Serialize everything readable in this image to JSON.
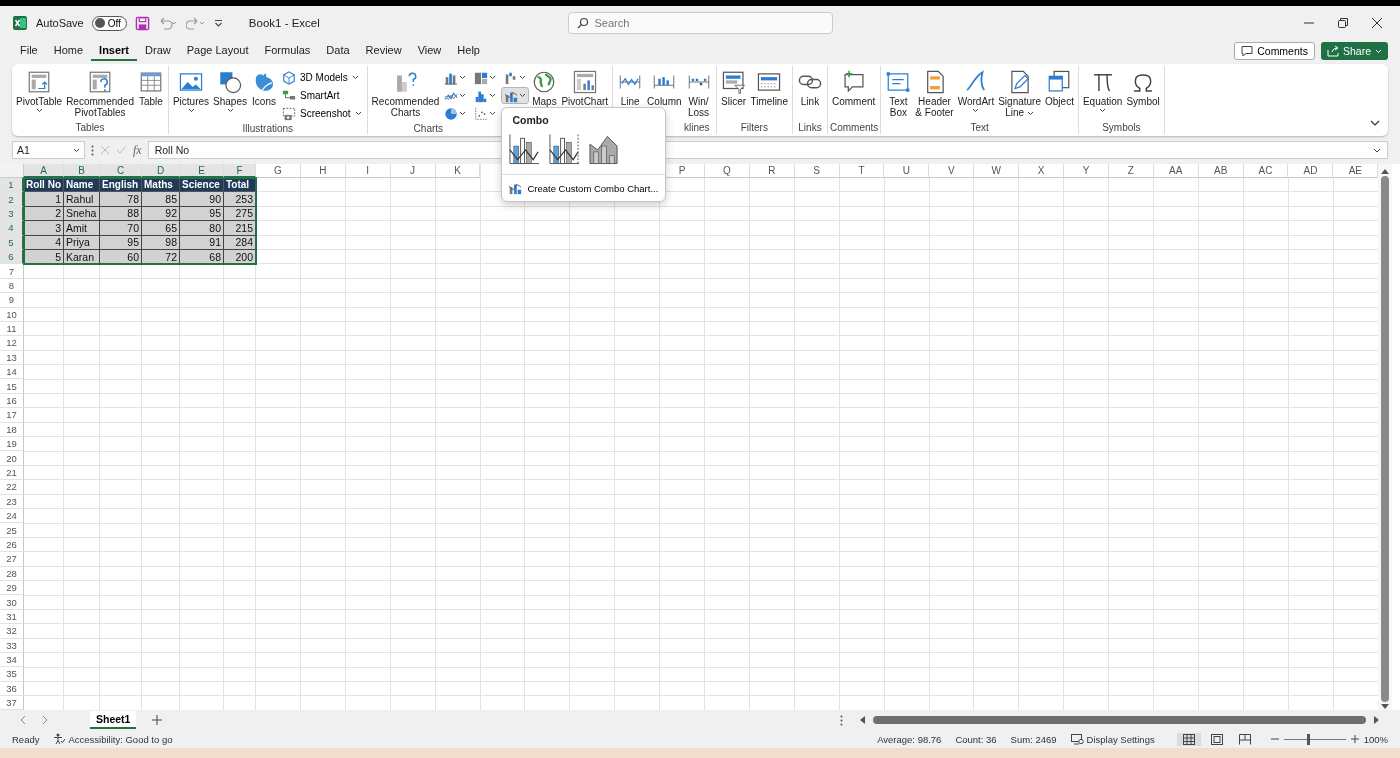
{
  "title_bar": {
    "autosave_label": "AutoSave",
    "autosave": {
      "on": false,
      "state_label": "Off"
    },
    "title": "Book1 - Excel",
    "search_placeholder": "Search"
  },
  "menu_tabs": [
    {
      "label": "File",
      "selected": false
    },
    {
      "label": "Home",
      "selected": false
    },
    {
      "label": "Insert",
      "selected": true
    },
    {
      "label": "Draw",
      "selected": false
    },
    {
      "label": "Page Layout",
      "selected": false
    },
    {
      "label": "Formulas",
      "selected": false
    },
    {
      "label": "Data",
      "selected": false
    },
    {
      "label": "Review",
      "selected": false
    },
    {
      "label": "View",
      "selected": false
    },
    {
      "label": "Help",
      "selected": false
    }
  ],
  "comments_button": "Comments",
  "share_button": "Share",
  "ribbon_groups": [
    {
      "label": "Tables",
      "items": [
        {
          "kind": "large",
          "label": "PivotTable",
          "caret": true
        },
        {
          "kind": "large",
          "label": "Recommended\nPivotTables",
          "caret": false
        },
        {
          "kind": "large",
          "label": "Table",
          "caret": false
        }
      ]
    },
    {
      "label": "Illustrations",
      "items": [
        {
          "kind": "large",
          "label": "Pictures",
          "caret": true
        },
        {
          "kind": "large",
          "label": "Shapes",
          "caret": true
        },
        {
          "kind": "large",
          "label": "Icons",
          "caret": false
        },
        {
          "kind": "stack",
          "entries": [
            {
              "label": "3D Models",
              "caret": true
            },
            {
              "label": "SmartArt",
              "caret": false
            },
            {
              "label": "Screenshot",
              "caret": true
            }
          ]
        }
      ]
    },
    {
      "label": "Charts",
      "items": [
        {
          "kind": "large",
          "label": "Recommended\nCharts",
          "caret": false
        },
        {
          "kind": "chart_grid",
          "buttons": [
            {
              "selected": false
            },
            {
              "selected": false
            },
            {
              "selected": false
            },
            {
              "selected": false
            },
            {
              "selected": false
            },
            {
              "selected": true
            },
            {
              "selected": false
            },
            {
              "selected": false
            }
          ]
        },
        {
          "kind": "large",
          "label": "Maps",
          "caret": false
        },
        {
          "kind": "large",
          "label": "PivotChart",
          "caret": false
        }
      ]
    },
    {
      "label": "klines",
      "items": [
        {
          "kind": "large",
          "label": "Line",
          "caret": false
        },
        {
          "kind": "large",
          "label": "Column",
          "caret": false
        },
        {
          "kind": "large",
          "label": "Win/\nLoss",
          "caret": false
        }
      ]
    },
    {
      "label": "Filters",
      "items": [
        {
          "kind": "large",
          "label": "Slicer",
          "caret": false
        },
        {
          "kind": "large",
          "label": "Timeline",
          "caret": false
        }
      ]
    },
    {
      "label": "Links",
      "items": [
        {
          "kind": "large",
          "label": "Link",
          "caret": false
        }
      ]
    },
    {
      "label": "Comments",
      "items": [
        {
          "kind": "large",
          "label": "Comment",
          "caret": false
        }
      ]
    },
    {
      "label": "Text",
      "items": [
        {
          "kind": "large",
          "label": "Text\nBox",
          "caret": false
        },
        {
          "kind": "large",
          "label": "Header\n& Footer",
          "caret": false
        },
        {
          "kind": "large",
          "label": "WordArt",
          "caret": true
        },
        {
          "kind": "large",
          "label": "Signature\nLine",
          "caret": true
        },
        {
          "kind": "large",
          "label": "Object",
          "caret": false
        }
      ]
    },
    {
      "label": "Symbols",
      "items": [
        {
          "kind": "large",
          "label": "Equation",
          "caret": true
        },
        {
          "kind": "large",
          "label": "Symbol",
          "caret": false
        }
      ]
    }
  ],
  "combo_menu": {
    "title": "Combo",
    "action": "Create Custom Combo Chart..."
  },
  "formula_bar": {
    "name_box": "A1",
    "function_label": "fx",
    "formula": "Roll No"
  },
  "sheet": {
    "columns": [
      {
        "label": "A",
        "selected": true
      },
      {
        "label": "B",
        "selected": true
      },
      {
        "label": "C",
        "selected": true
      },
      {
        "label": "D",
        "selected": true
      },
      {
        "label": "E",
        "selected": true
      },
      {
        "label": "F",
        "selected": true
      },
      {
        "label": "G",
        "selected": false
      },
      {
        "label": "H",
        "selected": false
      },
      {
        "label": "I",
        "selected": false
      },
      {
        "label": "J",
        "selected": false
      },
      {
        "label": "K",
        "selected": false
      },
      {},
      {},
      {},
      {},
      {
        "label": "P",
        "selected": false
      },
      {
        "label": "Q",
        "selected": false
      },
      {
        "label": "R",
        "selected": false
      },
      {
        "label": "S",
        "selected": false
      },
      {
        "label": "T",
        "selected": false
      },
      {
        "label": "U",
        "selected": false
      },
      {
        "label": "V",
        "selected": false
      },
      {
        "label": "W",
        "selected": false
      },
      {
        "label": "X",
        "selected": false
      },
      {
        "label": "Y",
        "selected": false
      },
      {
        "label": "Z",
        "selected": false
      },
      {
        "label": "AA",
        "selected": false
      },
      {
        "label": "AB",
        "selected": false
      },
      {
        "label": "AC",
        "selected": false
      },
      {
        "label": "AD",
        "selected": false
      },
      {
        "label": "AE",
        "selected": false
      }
    ],
    "rows": [
      {
        "label": "1",
        "selected": true,
        "kind": "header",
        "cells": [
          "Roll No",
          "Name",
          "English",
          "Maths",
          "Science",
          "Total"
        ]
      },
      {
        "label": "2",
        "selected": true,
        "kind": "data",
        "cells": [
          "1",
          "Rahul",
          "78",
          "85",
          "90",
          "253"
        ]
      },
      {
        "label": "3",
        "selected": true,
        "kind": "data",
        "cells": [
          "2",
          "Sneha",
          "88",
          "92",
          "95",
          "275"
        ]
      },
      {
        "label": "4",
        "selected": true,
        "kind": "data",
        "cells": [
          "3",
          "Amit",
          "70",
          "65",
          "80",
          "215"
        ]
      },
      {
        "label": "5",
        "selected": true,
        "kind": "data",
        "cells": [
          "4",
          "Priya",
          "95",
          "98",
          "91",
          "284"
        ]
      },
      {
        "label": "6",
        "selected": true,
        "kind": "data",
        "cells": [
          "5",
          "Karan",
          "60",
          "72",
          "68",
          "200"
        ]
      },
      {
        "label": "7",
        "selected": false,
        "kind": "empty"
      },
      {
        "label": "8",
        "selected": false,
        "kind": "empty"
      },
      {
        "label": "9",
        "selected": false,
        "kind": "empty"
      },
      {
        "label": "10",
        "selected": false,
        "kind": "empty"
      },
      {
        "label": "11",
        "selected": false,
        "kind": "empty"
      },
      {
        "label": "12",
        "selected": false,
        "kind": "empty"
      },
      {
        "label": "13",
        "selected": false,
        "kind": "empty"
      },
      {
        "label": "14",
        "selected": false,
        "kind": "empty"
      },
      {
        "label": "15",
        "selected": false,
        "kind": "empty"
      },
      {
        "label": "16",
        "selected": false,
        "kind": "empty"
      },
      {
        "label": "17",
        "selected": false,
        "kind": "empty"
      },
      {
        "label": "18",
        "selected": false,
        "kind": "empty"
      },
      {
        "label": "19",
        "selected": false,
        "kind": "empty"
      },
      {
        "label": "20",
        "selected": false,
        "kind": "empty"
      },
      {
        "label": "21",
        "selected": false,
        "kind": "empty"
      },
      {
        "label": "22",
        "selected": false,
        "kind": "empty"
      },
      {
        "label": "23",
        "selected": false,
        "kind": "empty"
      },
      {
        "label": "24",
        "selected": false,
        "kind": "empty"
      },
      {
        "label": "25",
        "selected": false,
        "kind": "empty"
      },
      {
        "label": "26",
        "selected": false,
        "kind": "empty"
      },
      {
        "label": "27",
        "selected": false,
        "kind": "empty"
      },
      {
        "label": "28",
        "selected": false,
        "kind": "empty"
      },
      {
        "label": "29",
        "selected": false,
        "kind": "empty"
      },
      {
        "label": "30",
        "selected": false,
        "kind": "empty"
      },
      {
        "label": "31",
        "selected": false,
        "kind": "empty"
      },
      {
        "label": "32",
        "selected": false,
        "kind": "empty"
      },
      {
        "label": "33",
        "selected": false,
        "kind": "empty"
      },
      {
        "label": "34",
        "selected": false,
        "kind": "empty"
      },
      {
        "label": "35",
        "selected": false,
        "kind": "empty"
      },
      {
        "label": "36",
        "selected": false,
        "kind": "empty"
      },
      {
        "label": "37",
        "selected": false,
        "kind": "empty"
      }
    ]
  },
  "sheet_tabs": [
    {
      "label": "Sheet1",
      "selected": true
    }
  ],
  "status_bar": {
    "mode": "Ready",
    "accessibility": "Accessibility: Good to go",
    "average": "Average: 98.76",
    "count": "Count: 36",
    "sum": "Sum: 2469",
    "display_settings": "Display Settings",
    "views": [
      {
        "selected": true
      },
      {
        "selected": false
      },
      {
        "selected": false
      }
    ],
    "zoom": {
      "level": 0.4,
      "label": "100%"
    }
  }
}
